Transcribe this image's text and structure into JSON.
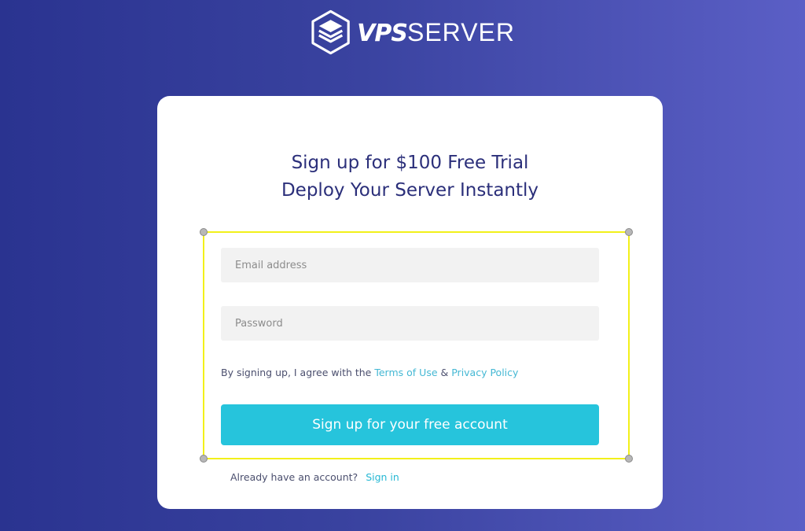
{
  "brand": {
    "logo_icon": "stacked-layers-hexagon-icon",
    "name_bold": "VPS",
    "name_light": "SERVER"
  },
  "signup": {
    "heading_line1": "Sign up for $100 Free Trial",
    "heading_line2": "Deploy Your Server Instantly",
    "email_placeholder": "Email address",
    "password_placeholder": "Password",
    "terms_prefix": "By signing up, I agree with the ",
    "terms_link": "Terms of Use",
    "terms_amp": " & ",
    "privacy_link": "Privacy Policy",
    "submit_label": "Sign up for your free account",
    "signin_prompt": "Already have an account?",
    "signin_link": "Sign in"
  },
  "colors": {
    "background_start": "#2a3390",
    "background_end": "#5b5fc6",
    "heading": "#2b2f7a",
    "button": "#26c4dc",
    "link": "#45b8d4",
    "selection_outline": "#f2f01a"
  }
}
